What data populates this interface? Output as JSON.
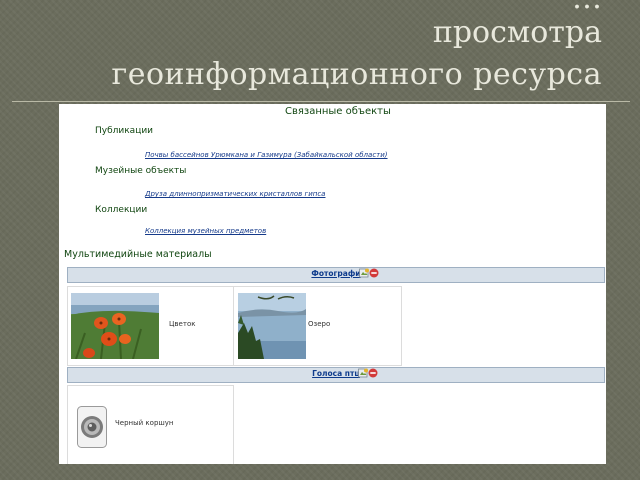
{
  "slide": {
    "title_lines": [
      "…",
      "просмотра",
      "геоинформационного ресурса"
    ]
  },
  "linked": {
    "header": "Связанные объекты",
    "groups": [
      {
        "heading": "Публикации",
        "link": "Почвы бассейнов Урюмкана и Газимура (Забайкальской области)"
      },
      {
        "heading": "Музейные объекты",
        "link": "Друза длиннопризматических кристаллов гипса"
      },
      {
        "heading": "Коллекции",
        "link": "Коллекция музейных предметов"
      }
    ]
  },
  "media": {
    "header": "Мультимедийные материалы",
    "sections": [
      {
        "title": "Фотографи",
        "items": [
          {
            "label": "Цветок",
            "thumb": "flower-photo"
          },
          {
            "label": "Озеро",
            "thumb": "lake-photo"
          }
        ]
      },
      {
        "title": "Голоса птц",
        "items": [
          {
            "label": "Черный коршун",
            "thumb": "audio-speaker-icon"
          }
        ]
      }
    ]
  },
  "colors": {
    "background": "#6b6d5d",
    "title_text": "#e8e8dc",
    "heading_green": "#114611",
    "link_blue": "#153a8a",
    "bar_fill": "#d7e0e9"
  }
}
